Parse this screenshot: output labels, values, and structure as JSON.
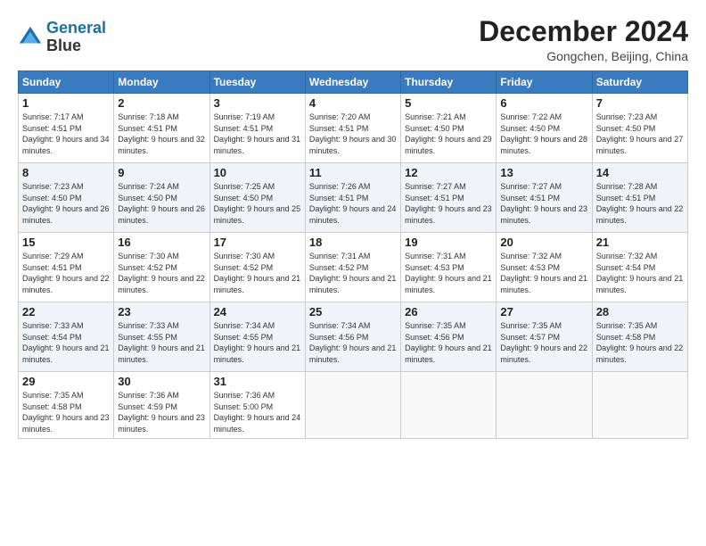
{
  "header": {
    "logo_line1": "General",
    "logo_line2": "Blue",
    "month": "December 2024",
    "location": "Gongchen, Beijing, China"
  },
  "weekdays": [
    "Sunday",
    "Monday",
    "Tuesday",
    "Wednesday",
    "Thursday",
    "Friday",
    "Saturday"
  ],
  "weeks": [
    [
      {
        "day": "1",
        "sunrise": "7:17 AM",
        "sunset": "4:51 PM",
        "daylight": "9 hours and 34 minutes."
      },
      {
        "day": "2",
        "sunrise": "7:18 AM",
        "sunset": "4:51 PM",
        "daylight": "9 hours and 32 minutes."
      },
      {
        "day": "3",
        "sunrise": "7:19 AM",
        "sunset": "4:51 PM",
        "daylight": "9 hours and 31 minutes."
      },
      {
        "day": "4",
        "sunrise": "7:20 AM",
        "sunset": "4:51 PM",
        "daylight": "9 hours and 30 minutes."
      },
      {
        "day": "5",
        "sunrise": "7:21 AM",
        "sunset": "4:50 PM",
        "daylight": "9 hours and 29 minutes."
      },
      {
        "day": "6",
        "sunrise": "7:22 AM",
        "sunset": "4:50 PM",
        "daylight": "9 hours and 28 minutes."
      },
      {
        "day": "7",
        "sunrise": "7:23 AM",
        "sunset": "4:50 PM",
        "daylight": "9 hours and 27 minutes."
      }
    ],
    [
      {
        "day": "8",
        "sunrise": "7:23 AM",
        "sunset": "4:50 PM",
        "daylight": "9 hours and 26 minutes."
      },
      {
        "day": "9",
        "sunrise": "7:24 AM",
        "sunset": "4:50 PM",
        "daylight": "9 hours and 26 minutes."
      },
      {
        "day": "10",
        "sunrise": "7:25 AM",
        "sunset": "4:50 PM",
        "daylight": "9 hours and 25 minutes."
      },
      {
        "day": "11",
        "sunrise": "7:26 AM",
        "sunset": "4:51 PM",
        "daylight": "9 hours and 24 minutes."
      },
      {
        "day": "12",
        "sunrise": "7:27 AM",
        "sunset": "4:51 PM",
        "daylight": "9 hours and 23 minutes."
      },
      {
        "day": "13",
        "sunrise": "7:27 AM",
        "sunset": "4:51 PM",
        "daylight": "9 hours and 23 minutes."
      },
      {
        "day": "14",
        "sunrise": "7:28 AM",
        "sunset": "4:51 PM",
        "daylight": "9 hours and 22 minutes."
      }
    ],
    [
      {
        "day": "15",
        "sunrise": "7:29 AM",
        "sunset": "4:51 PM",
        "daylight": "9 hours and 22 minutes."
      },
      {
        "day": "16",
        "sunrise": "7:30 AM",
        "sunset": "4:52 PM",
        "daylight": "9 hours and 22 minutes."
      },
      {
        "day": "17",
        "sunrise": "7:30 AM",
        "sunset": "4:52 PM",
        "daylight": "9 hours and 21 minutes."
      },
      {
        "day": "18",
        "sunrise": "7:31 AM",
        "sunset": "4:52 PM",
        "daylight": "9 hours and 21 minutes."
      },
      {
        "day": "19",
        "sunrise": "7:31 AM",
        "sunset": "4:53 PM",
        "daylight": "9 hours and 21 minutes."
      },
      {
        "day": "20",
        "sunrise": "7:32 AM",
        "sunset": "4:53 PM",
        "daylight": "9 hours and 21 minutes."
      },
      {
        "day": "21",
        "sunrise": "7:32 AM",
        "sunset": "4:54 PM",
        "daylight": "9 hours and 21 minutes."
      }
    ],
    [
      {
        "day": "22",
        "sunrise": "7:33 AM",
        "sunset": "4:54 PM",
        "daylight": "9 hours and 21 minutes."
      },
      {
        "day": "23",
        "sunrise": "7:33 AM",
        "sunset": "4:55 PM",
        "daylight": "9 hours and 21 minutes."
      },
      {
        "day": "24",
        "sunrise": "7:34 AM",
        "sunset": "4:55 PM",
        "daylight": "9 hours and 21 minutes."
      },
      {
        "day": "25",
        "sunrise": "7:34 AM",
        "sunset": "4:56 PM",
        "daylight": "9 hours and 21 minutes."
      },
      {
        "day": "26",
        "sunrise": "7:35 AM",
        "sunset": "4:56 PM",
        "daylight": "9 hours and 21 minutes."
      },
      {
        "day": "27",
        "sunrise": "7:35 AM",
        "sunset": "4:57 PM",
        "daylight": "9 hours and 22 minutes."
      },
      {
        "day": "28",
        "sunrise": "7:35 AM",
        "sunset": "4:58 PM",
        "daylight": "9 hours and 22 minutes."
      }
    ],
    [
      {
        "day": "29",
        "sunrise": "7:35 AM",
        "sunset": "4:58 PM",
        "daylight": "9 hours and 23 minutes."
      },
      {
        "day": "30",
        "sunrise": "7:36 AM",
        "sunset": "4:59 PM",
        "daylight": "9 hours and 23 minutes."
      },
      {
        "day": "31",
        "sunrise": "7:36 AM",
        "sunset": "5:00 PM",
        "daylight": "9 hours and 24 minutes."
      },
      null,
      null,
      null,
      null
    ]
  ]
}
